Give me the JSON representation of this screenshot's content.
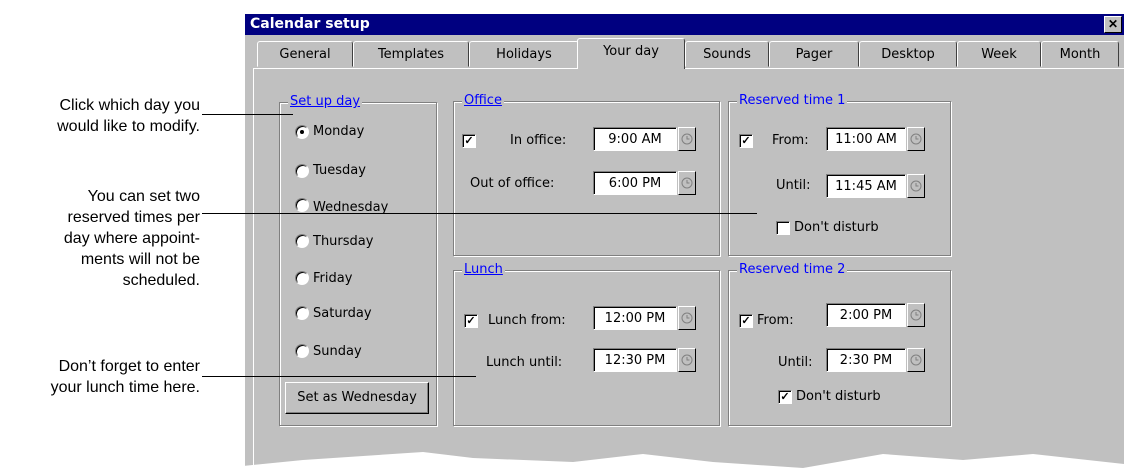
{
  "annotations": [
    {
      "line1": "Click which day you",
      "line2": "would like to modify."
    },
    {
      "line1": "You can set two",
      "line2": "reserved times per",
      "line3": "day where appoint-",
      "line4": "ments will not be",
      "line5": "scheduled."
    },
    {
      "line1": "Don’t forget to enter",
      "line2": "your lunch time here."
    }
  ],
  "window": {
    "title": "Calendar setup",
    "close": "✕"
  },
  "tabs": [
    "General",
    "Templates",
    "Holidays",
    "Your day",
    "Sounds",
    "Pager",
    "Desktop",
    "Week",
    "Month"
  ],
  "active_tab": "Your day",
  "setup_day": {
    "legend": "Set up day",
    "days": [
      "Monday",
      "Tuesday",
      "Wednesday",
      "Thursday",
      "Friday",
      "Saturday",
      "Sunday"
    ],
    "selected": "Monday",
    "button": "Set as Wednesday"
  },
  "office": {
    "legend": "Office",
    "in_office_label": "In office:",
    "in_office_checked": true,
    "in_office_value": "9:00 AM",
    "out_label": "Out of office:",
    "out_value": "6:00 PM"
  },
  "reserved1": {
    "legend": "Reserved time 1",
    "from_label": "From:",
    "from_checked": true,
    "from_value": "11:00 AM",
    "until_label": "Until:",
    "until_value": "11:45 AM",
    "dont_disturb_label": "Don't disturb",
    "dont_disturb_checked": false
  },
  "lunch": {
    "legend": "Lunch",
    "from_label": "Lunch from:",
    "from_checked": true,
    "from_value": "12:00 PM",
    "until_label": "Lunch until:",
    "until_value": "12:30 PM"
  },
  "reserved2": {
    "legend": "Reserved time 2",
    "from_label": "From:",
    "from_checked": true,
    "from_value": "2:00 PM",
    "until_label": "Until:",
    "until_value": "2:30 PM",
    "dont_disturb_label": "Don't disturb",
    "dont_disturb_checked": true
  },
  "icons": {
    "clock": "clock-icon",
    "check": "✓"
  }
}
